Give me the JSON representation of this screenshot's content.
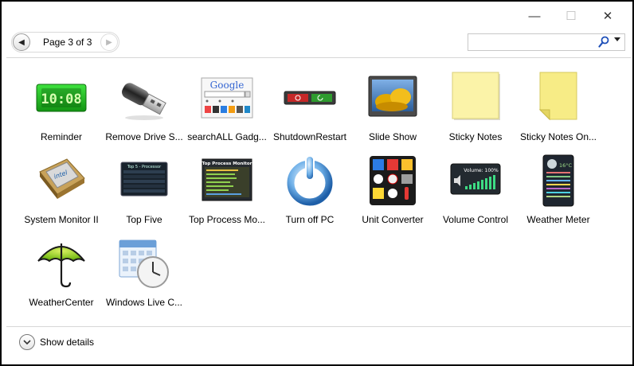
{
  "window": {
    "min_glyph": "—",
    "max_glyph": "☐",
    "close_glyph": "✕"
  },
  "nav": {
    "page_label": "Page 3 of 3"
  },
  "search": {
    "placeholder": "",
    "value": ""
  },
  "gadgets": [
    {
      "name": "Reminder",
      "icon": "green-led-clock-icon",
      "clock_text": "10:08"
    },
    {
      "name": "Remove Drive S...",
      "icon": "usb-drive-icon"
    },
    {
      "name": "searchALL Gadg...",
      "icon": "google-search-icon",
      "logo_text": "Google"
    },
    {
      "name": "ShutdownRestart",
      "icon": "shutdown-restart-bar-icon"
    },
    {
      "name": "Slide Show",
      "icon": "slideshow-photo-icon"
    },
    {
      "name": "Sticky Notes",
      "icon": "sticky-note-icon"
    },
    {
      "name": "Sticky Notes On...",
      "icon": "sticky-note-folded-icon"
    },
    {
      "name": "System Monitor II",
      "icon": "cpu-chip-icon",
      "chip_text": "intel"
    },
    {
      "name": "Top Five",
      "icon": "top-five-panel-icon",
      "panel_title": "Top 5 - Processor"
    },
    {
      "name": "Top Process Mo...",
      "icon": "top-process-monitor-icon",
      "panel_title": "Top Process Monitor"
    },
    {
      "name": "Turn off PC",
      "icon": "power-button-icon"
    },
    {
      "name": "Unit Converter",
      "icon": "unit-converter-icon"
    },
    {
      "name": "Volume Control",
      "icon": "volume-control-icon",
      "panel_title": "Volume: 100%"
    },
    {
      "name": "Weather Meter",
      "icon": "weather-meter-icon",
      "temp_text": "16°C"
    },
    {
      "name": "WeatherCenter",
      "icon": "umbrella-icon"
    },
    {
      "name": "Windows Live C...",
      "icon": "calendar-clock-icon"
    }
  ],
  "footer": {
    "details_label": "Show details"
  },
  "colors": {
    "separator": "#d7d7d7",
    "led_green": "#2bd12b",
    "sticky_yellow": "#fbf3a8"
  }
}
